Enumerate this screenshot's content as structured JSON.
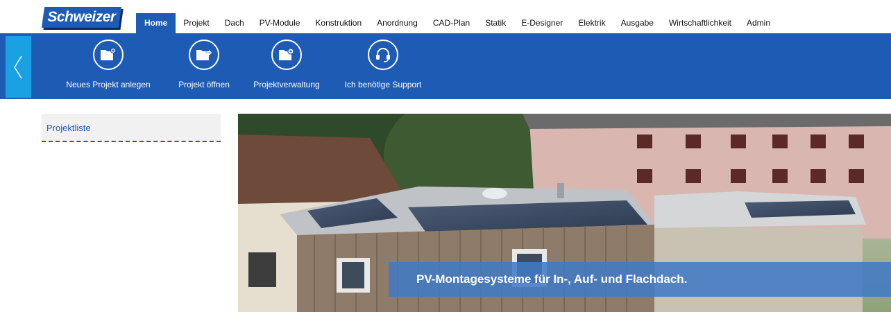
{
  "brand": {
    "logo_text": "Schweizer"
  },
  "nav": {
    "tabs": [
      "Home",
      "Projekt",
      "Dach",
      "PV-Module",
      "Konstruktion",
      "Anordnung",
      "CAD-Plan",
      "Statik",
      "E-Designer",
      "Elektrik",
      "Ausgabe",
      "Wirtschaftlichkeit",
      "Admin"
    ],
    "active_tab": "Home"
  },
  "ribbon": {
    "buttons": [
      {
        "label": "Neues Projekt anlegen",
        "icon": "new-folder-icon"
      },
      {
        "label": "Projekt öffnen",
        "icon": "open-folder-icon"
      },
      {
        "label": "Projektverwaltung",
        "icon": "folder-settings-icon"
      },
      {
        "label": "Ich benötige Support",
        "icon": "headset-icon"
      }
    ],
    "collapse_icon": "chevron-left-icon"
  },
  "sidebar": {
    "tab_label": "Projektliste"
  },
  "hero": {
    "caption": "PV-Montagesysteme für In-, Auf- und Flachdach."
  },
  "colors": {
    "primary": "#1d5bb4",
    "toggle": "#1aa1e3",
    "sidebar_bg": "#f1f1f1"
  }
}
